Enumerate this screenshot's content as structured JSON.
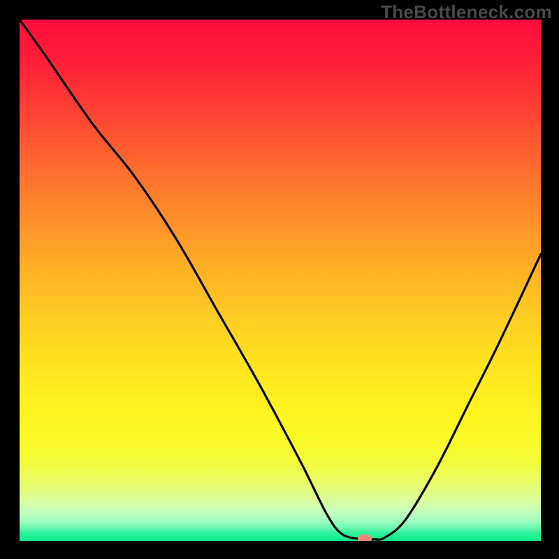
{
  "watermark": "TheBottleneck.com",
  "chart_data": {
    "type": "line",
    "title": "",
    "xlabel": "",
    "ylabel": "",
    "x": [
      0.0,
      0.05,
      0.14,
      0.22,
      0.3,
      0.38,
      0.46,
      0.54,
      0.59,
      0.62,
      0.66,
      0.68,
      0.7,
      0.74,
      0.8,
      0.86,
      0.92,
      1.0
    ],
    "values": [
      1.0,
      0.93,
      0.8,
      0.7,
      0.58,
      0.44,
      0.3,
      0.15,
      0.05,
      0.012,
      0.003,
      0.003,
      0.006,
      0.04,
      0.14,
      0.26,
      0.38,
      0.55
    ],
    "xlim": [
      0,
      1
    ],
    "ylim": [
      0,
      1
    ],
    "marker": {
      "x": 0.662,
      "y": 0.004
    },
    "background_gradient_meaning": "bottleneck severity (top=red=high, bottom=green=low)"
  },
  "colors": {
    "curve": "#000000",
    "marker": "#ec8a7a",
    "frame": "#000000",
    "watermark": "#4a4a4a"
  }
}
